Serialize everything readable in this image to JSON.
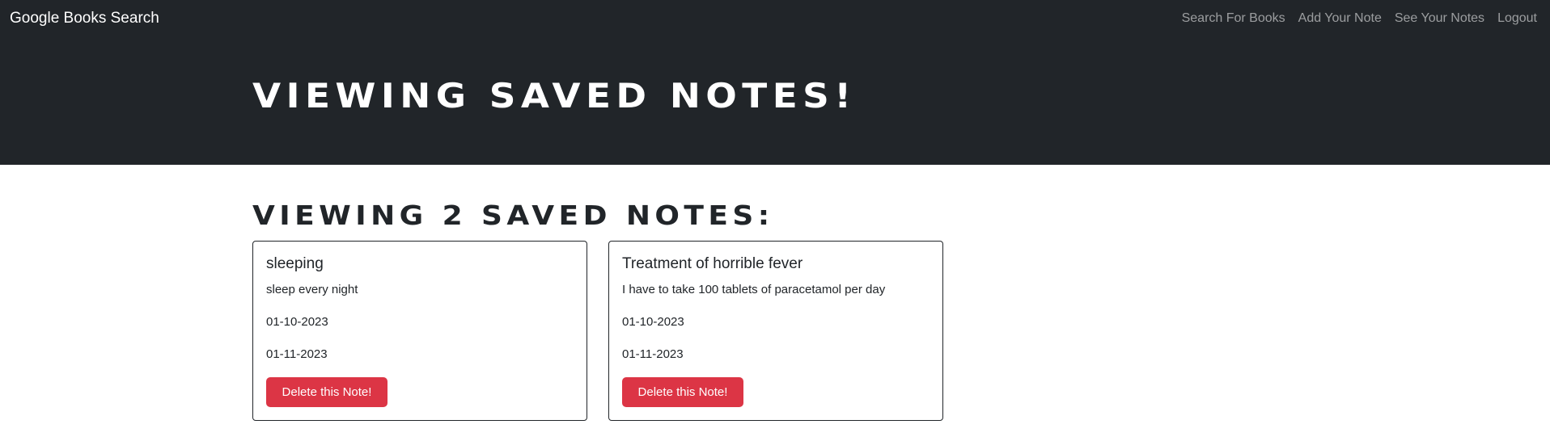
{
  "navbar": {
    "brand": "Google Books Search",
    "links": [
      "Search For Books",
      "Add Your Note",
      "See Your Notes",
      "Logout"
    ]
  },
  "hero": {
    "title": "VIEWING SAVED NOTES!"
  },
  "main": {
    "heading": "VIEWING 2 SAVED NOTES:",
    "notes": [
      {
        "title": "sleeping",
        "body": "sleep every night",
        "date1": "01-10-2023",
        "date2": "01-11-2023",
        "delete_label": "Delete this Note!"
      },
      {
        "title": "Treatment of horrible fever",
        "body": "I have to take 100 tablets of paracetamol per day",
        "date1": "01-10-2023",
        "date2": "01-11-2023",
        "delete_label": "Delete this Note!"
      }
    ]
  },
  "colors": {
    "dark": "#212529",
    "danger": "#dc3545"
  }
}
